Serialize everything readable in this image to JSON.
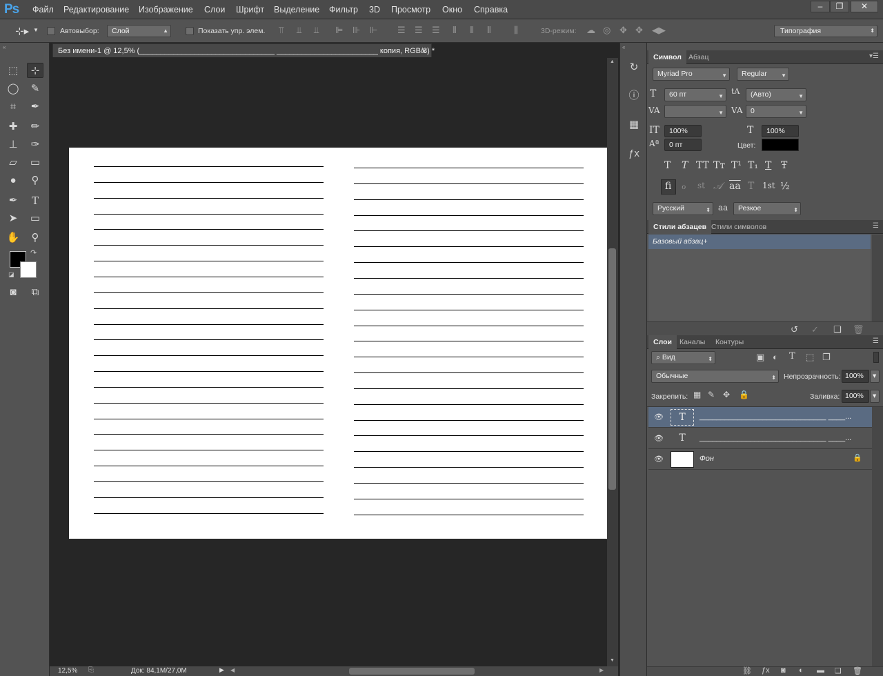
{
  "app": {
    "logo": "Ps",
    "menu": [
      "Файл",
      "Редактирование",
      "Изображение",
      "Слои",
      "Шрифт",
      "Выделение",
      "Фильтр",
      "3D",
      "Просмотр",
      "Окно",
      "Справка"
    ],
    "window_controls": [
      "–",
      "❐",
      "✕"
    ]
  },
  "options_bar": {
    "autoselect_label": "Автовыбор:",
    "autoselect_value": "Слой",
    "show_transform_label": "Показать упр. элем.",
    "mode3d_label": "3D-режим:",
    "workspace": "Типография"
  },
  "document": {
    "tab_title": "Без имени-1 @ 12,5% (________________________________ ________________________ копия, RGB/8) *",
    "tab_close": "×",
    "zoom": "12,5%",
    "doc_size": "Док: 84,1M/27,0M",
    "line_count_per_column": 23
  },
  "character_panel": {
    "tabs": [
      "Символ",
      "Абзац"
    ],
    "font_family": "Myriad Pro",
    "font_style": "Regular",
    "size": "60 пт",
    "leading": "(Авто)",
    "kerning": "",
    "tracking": "0",
    "vertical_scale": "100%",
    "horizontal_scale": "100%",
    "baseline_shift": "0 пт",
    "color_label": "Цвет:",
    "color_value": "#000000",
    "style_buttons": [
      "T",
      "T",
      "TT",
      "Tт",
      "T¹",
      "T₁",
      "T",
      "Ŧ"
    ],
    "opentype_buttons": [
      "ﬁ",
      "ℴ",
      "st",
      "𝒜",
      "aa",
      "T",
      "1st",
      "½"
    ],
    "language": "Русский",
    "antialias_glyph": "aa",
    "antialias": "Резкое"
  },
  "styles_panel": {
    "tabs": [
      "Стили абзацев",
      "Стили символов"
    ],
    "items": [
      "Базовый абзац+"
    ]
  },
  "layers_panel": {
    "tabs": [
      "Слои",
      "Каналы",
      "Контуры"
    ],
    "filter_value": "Вид",
    "blend_mode": "Обычные",
    "opacity_label": "Непрозрачность:",
    "opacity": "100%",
    "lock_label": "Закрепить:",
    "fill_label": "Заливка:",
    "fill": "100%",
    "layers": [
      {
        "name": "______________________________ ____...",
        "type": "text",
        "selected": true
      },
      {
        "name": "______________________________ ____...",
        "type": "text",
        "selected": false
      },
      {
        "name": "Фон",
        "type": "background",
        "selected": false
      }
    ]
  },
  "colors": {
    "selection": "#5a6b82",
    "panel_bg": "#535353",
    "canvas_bg": "#262626"
  }
}
